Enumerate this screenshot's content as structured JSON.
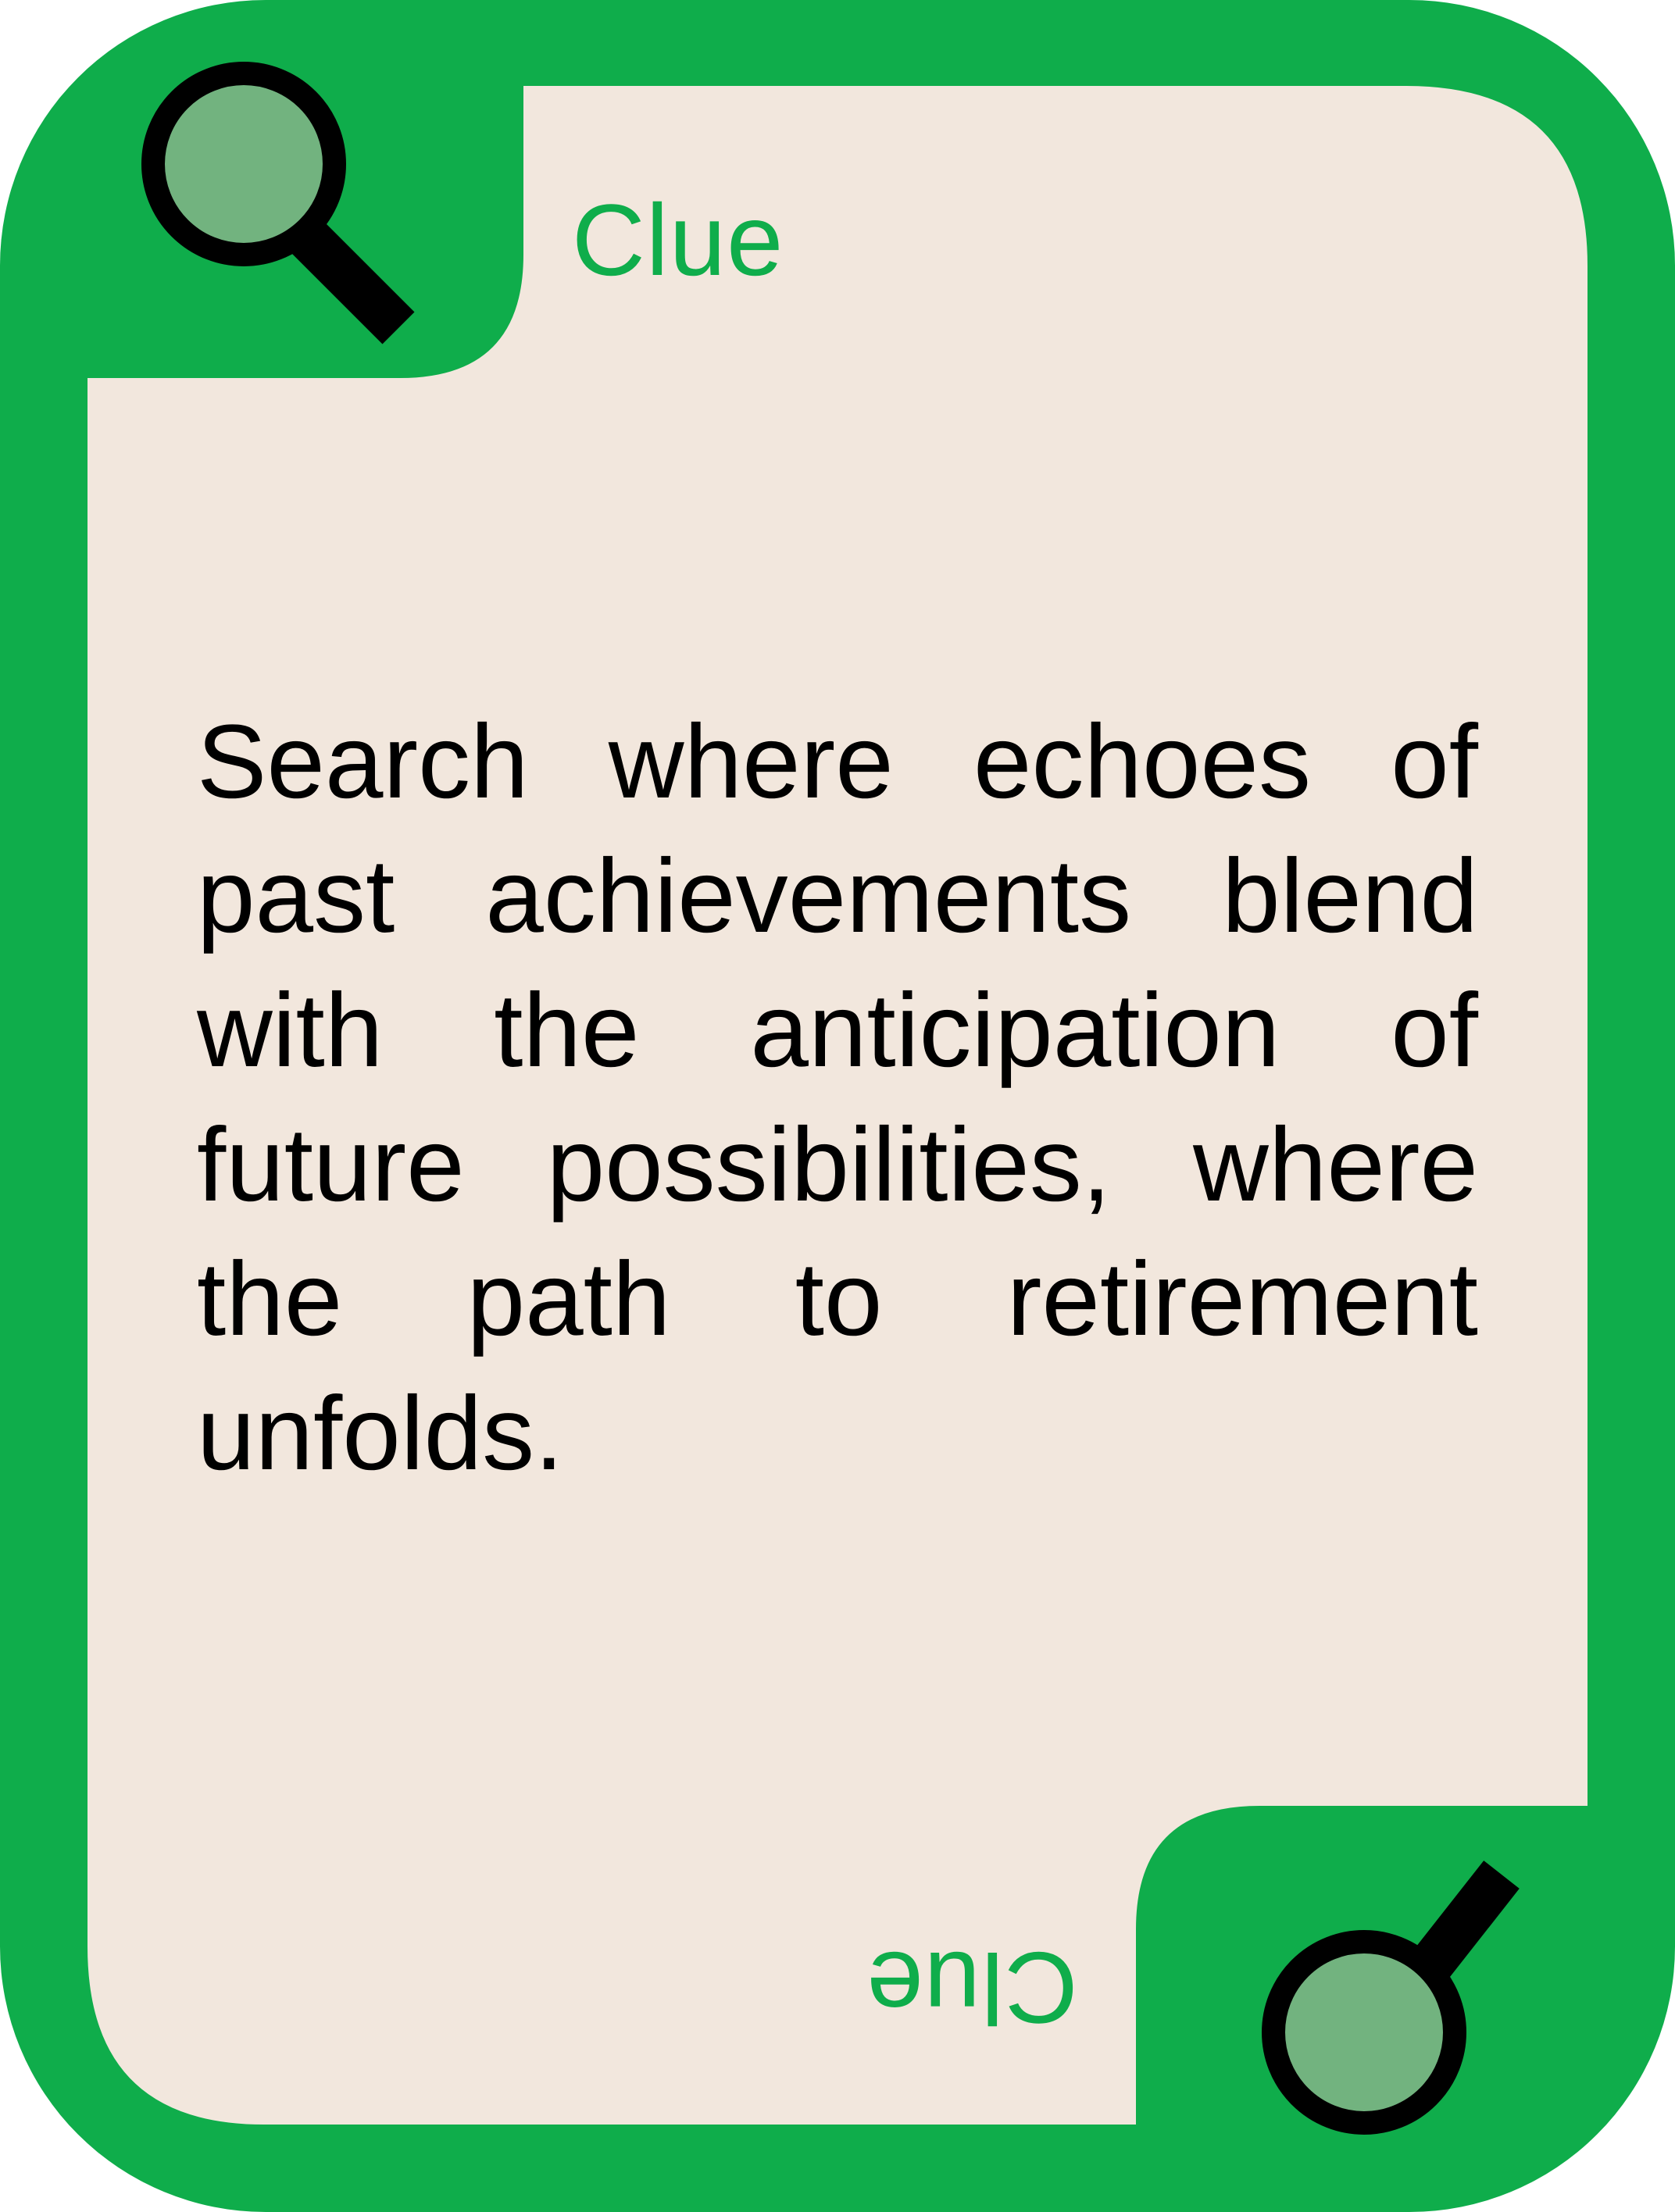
{
  "card": {
    "title": "Clue",
    "title_rotated": "Clue",
    "text": "Search where echoes of past achievements blend with the anticipation of future possibilities, where the path to retirement unfolds."
  },
  "icons": {
    "top_left": "magnifying-glass-icon",
    "bottom_right": "magnifying-glass-icon"
  },
  "colors": {
    "frame": "#0fad4b",
    "panel": "#f2e7dd",
    "lens": "#72b37f",
    "text": "#000000"
  }
}
